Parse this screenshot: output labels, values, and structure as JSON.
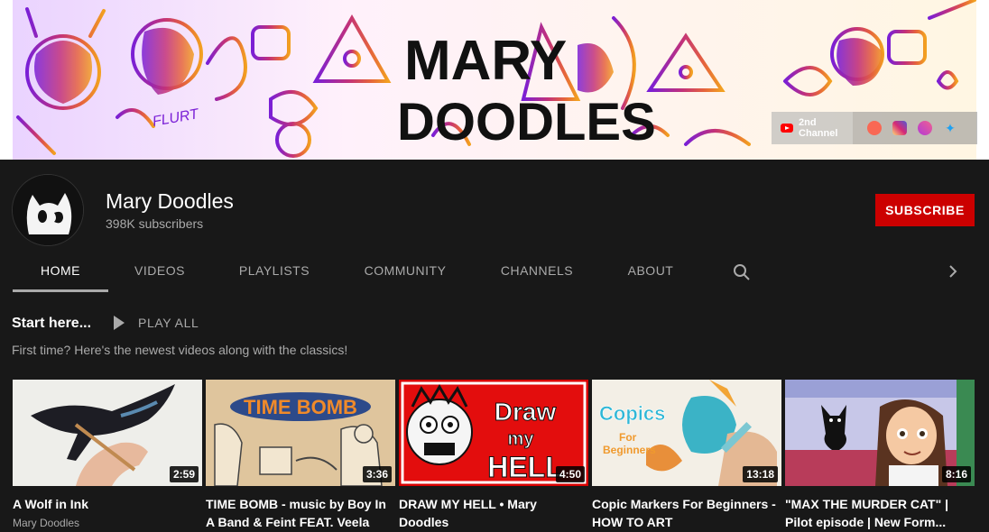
{
  "banner": {
    "art_text_line1": "MARY",
    "art_text_line2": "DOODLES",
    "art_text_flurt": "FLURT",
    "links": {
      "main_label": "2nd Channel",
      "icons": [
        "patreon-icon",
        "instagram-icon",
        "twitch-icon",
        "twitter-icon"
      ]
    }
  },
  "channel": {
    "name": "Mary Doodles",
    "subscribers": "398K subscribers",
    "subscribe_label": "SUBSCRIBE"
  },
  "tabs": [
    {
      "label": "HOME",
      "active": true
    },
    {
      "label": "VIDEOS",
      "active": false
    },
    {
      "label": "PLAYLISTS",
      "active": false
    },
    {
      "label": "COMMUNITY",
      "active": false
    },
    {
      "label": "CHANNELS",
      "active": false
    },
    {
      "label": "ABOUT",
      "active": false
    }
  ],
  "section": {
    "title": "Start here...",
    "play_all_label": "PLAY ALL",
    "subtitle": "First time? Here's the newest videos along with the classics!"
  },
  "videos": [
    {
      "title": "A Wolf in Ink",
      "duration": "2:59",
      "channel": "Mary Doodles",
      "thumb_text": ""
    },
    {
      "title": "TIME BOMB - music by Boy In A Band & Feint FEAT. Veela",
      "duration": "3:36",
      "channel": "",
      "thumb_text": "TIME BOMB"
    },
    {
      "title": "DRAW MY HELL • Mary Doodles",
      "duration": "4:50",
      "channel": "",
      "thumb_text": "Draw my HELL"
    },
    {
      "title": "Copic Markers For Beginners - HOW TO ART",
      "duration": "13:18",
      "channel": "",
      "thumb_text": "Copics For Beginners"
    },
    {
      "title": "\"MAX THE MURDER CAT\" | Pilot episode | New Form...",
      "duration": "8:16",
      "channel": "",
      "thumb_text": ""
    }
  ],
  "colors": {
    "background": "#181818",
    "subscribe": "#cc0000",
    "text_secondary": "#aaaaaa"
  }
}
